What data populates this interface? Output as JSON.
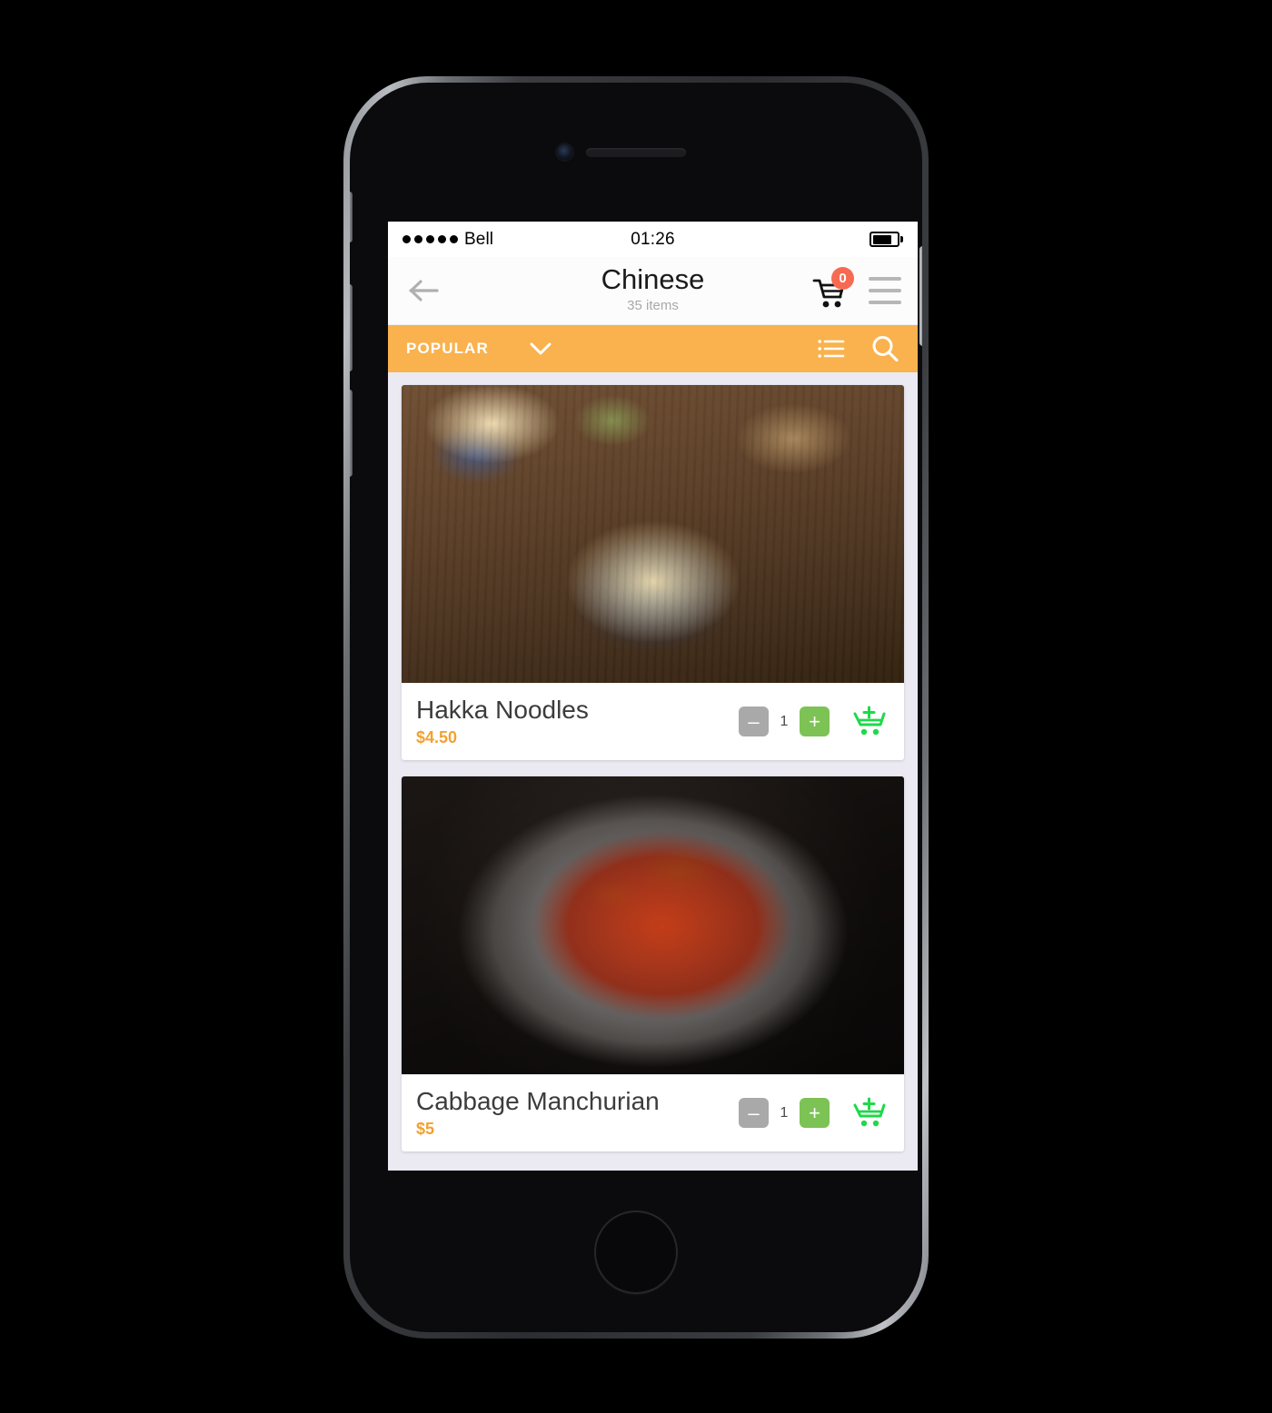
{
  "status_bar": {
    "carrier": "Bell",
    "signal_dots": 5,
    "time": "01:26",
    "battery_percent": 80
  },
  "nav_bar": {
    "back_icon": "arrow-left-icon",
    "title": "Chinese",
    "subtitle": "35 items",
    "cart_icon": "shopping-cart-icon",
    "cart_badge": "0",
    "menu_icon": "hamburger-menu-icon"
  },
  "filter_bar": {
    "label": "POPULAR",
    "chevron_icon": "chevron-down-icon",
    "list_icon": "list-view-icon",
    "search_icon": "search-icon",
    "background_color": "#f9b24d"
  },
  "colors": {
    "accent_orange": "#f9b24d",
    "price_orange": "#f2a131",
    "add_green": "#7dc254",
    "cart_green": "#1ed94a",
    "badge_red": "#f66a52",
    "minus_gray": "#a9a9a9",
    "screen_background": "#ebeaf3"
  },
  "items": [
    {
      "name": "Hakka Noodles",
      "price": "$4.50",
      "quantity": "1",
      "minus_label": "–",
      "plus_label": "+",
      "photo_alt": "bowl of hakka noodles with grilled chicken and chopsticks",
      "add_to_cart_icon": "add-to-cart-icon"
    },
    {
      "name": "Cabbage Manchurian",
      "price": "$5",
      "quantity": "1",
      "minus_label": "–",
      "plus_label": "+",
      "photo_alt": "steel bowl of cabbage manchurian garnished with spring onion",
      "add_to_cart_icon": "add-to-cart-icon"
    }
  ]
}
